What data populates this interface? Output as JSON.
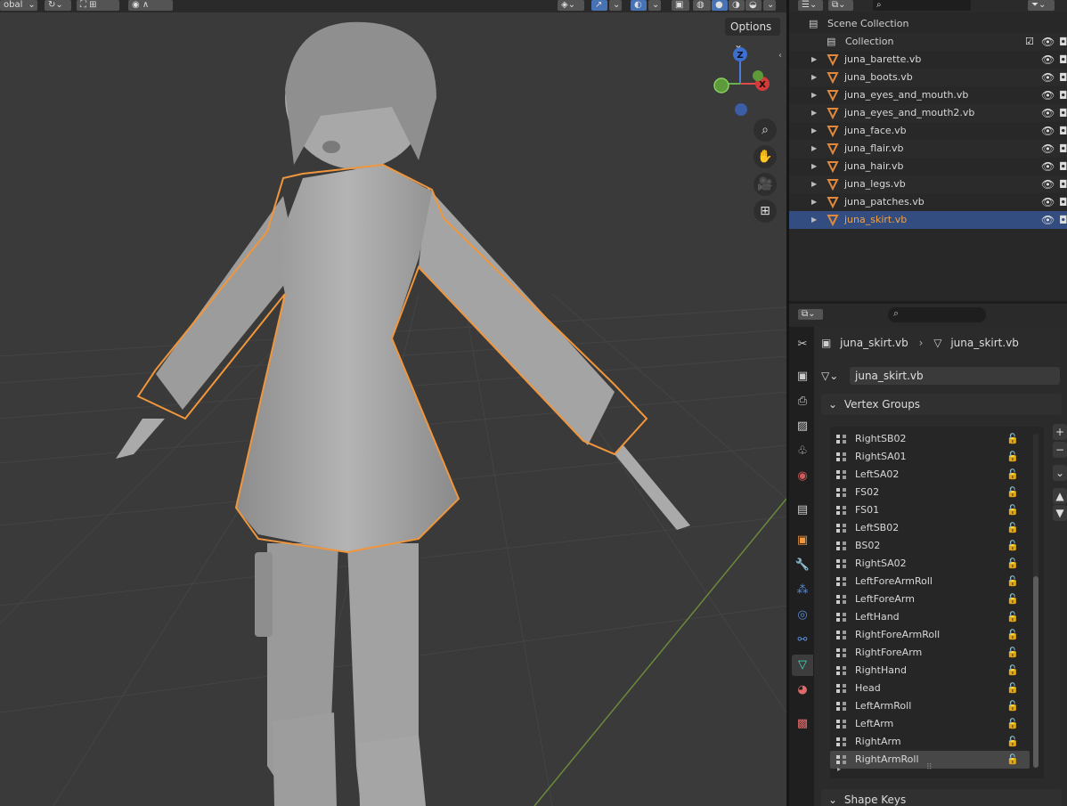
{
  "viewport": {
    "header": {
      "transform_label": "obal"
    },
    "options_label": "Options",
    "gizmo": {
      "z": "Z",
      "x": "X"
    },
    "nav_buttons": [
      "zoom-icon",
      "hand-icon",
      "camera-icon",
      "grid-icon"
    ]
  },
  "outliner": {
    "scene_collection": "Scene Collection",
    "collection": "Collection",
    "objects": [
      {
        "name": "juna_barette.vb"
      },
      {
        "name": "juna_boots.vb"
      },
      {
        "name": "juna_eyes_and_mouth.vb"
      },
      {
        "name": "juna_eyes_and_mouth2.vb"
      },
      {
        "name": "juna_face.vb"
      },
      {
        "name": "juna_flair.vb"
      },
      {
        "name": "juna_hair.vb"
      },
      {
        "name": "juna_legs.vb"
      },
      {
        "name": "juna_patches.vb"
      },
      {
        "name": "juna_skirt.vb",
        "selected": true
      }
    ]
  },
  "properties": {
    "breadcrumb_object": "juna_skirt.vb",
    "breadcrumb_mesh": "juna_skirt.vb",
    "mesh_name": "juna_skirt.vb",
    "vertex_groups_title": "Vertex Groups",
    "vertex_groups": [
      "RightSB02",
      "RightSA01",
      "LeftSA02",
      "FS02",
      "FS01",
      "LeftSB02",
      "BS02",
      "RightSA02",
      "LeftForeArmRoll",
      "LeftForeArm",
      "LeftHand",
      "RightForeArmRoll",
      "RightForeArm",
      "RightHand",
      "Head",
      "LeftArmRoll",
      "LeftArm",
      "RightArm",
      "RightArmRoll"
    ],
    "selected_vertex_group": "RightArmRoll",
    "shape_keys_title": "Shape Keys"
  },
  "colors": {
    "selection_outline": "#f0963c",
    "active_row": "#334d80",
    "mesh_icon": "#40e0c0",
    "object_icon": "#e0883c"
  }
}
